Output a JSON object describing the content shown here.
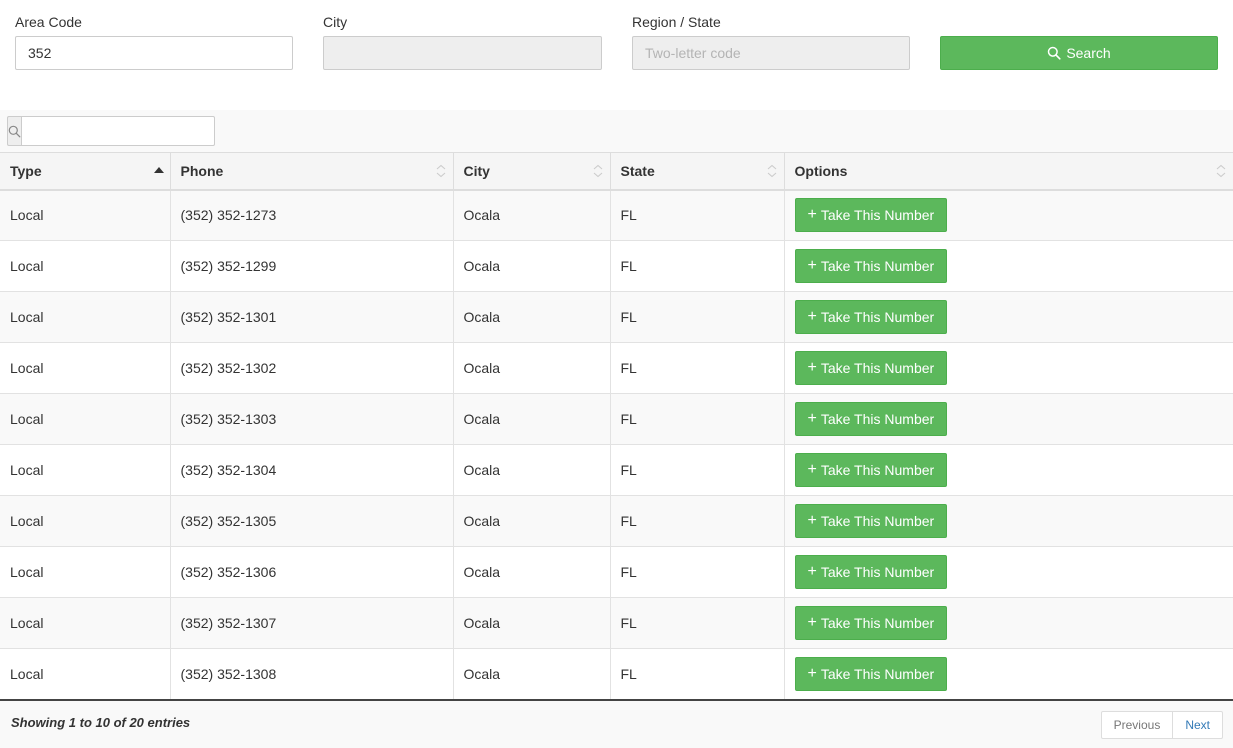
{
  "form": {
    "area_code_label": "Area Code",
    "area_code_value": "352",
    "city_label": "City",
    "city_value": "",
    "region_label": "Region / State",
    "region_placeholder": "Two-letter code",
    "search_label": "Search"
  },
  "table": {
    "filter_value": "",
    "columns": [
      "Type",
      "Phone",
      "City",
      "State",
      "Options"
    ],
    "sort_column": "Type",
    "sort_direction": "ascending",
    "action_label": "Take This Number",
    "rows": [
      {
        "type": "Local",
        "phone": "(352) 352-1273",
        "city": "Ocala",
        "state": "FL"
      },
      {
        "type": "Local",
        "phone": "(352) 352-1299",
        "city": "Ocala",
        "state": "FL"
      },
      {
        "type": "Local",
        "phone": "(352) 352-1301",
        "city": "Ocala",
        "state": "FL"
      },
      {
        "type": "Local",
        "phone": "(352) 352-1302",
        "city": "Ocala",
        "state": "FL"
      },
      {
        "type": "Local",
        "phone": "(352) 352-1303",
        "city": "Ocala",
        "state": "FL"
      },
      {
        "type": "Local",
        "phone": "(352) 352-1304",
        "city": "Ocala",
        "state": "FL"
      },
      {
        "type": "Local",
        "phone": "(352) 352-1305",
        "city": "Ocala",
        "state": "FL"
      },
      {
        "type": "Local",
        "phone": "(352) 352-1306",
        "city": "Ocala",
        "state": "FL"
      },
      {
        "type": "Local",
        "phone": "(352) 352-1307",
        "city": "Ocala",
        "state": "FL"
      },
      {
        "type": "Local",
        "phone": "(352) 352-1308",
        "city": "Ocala",
        "state": "FL"
      }
    ]
  },
  "footer": {
    "info": "Showing 1 to 10 of 20 entries",
    "previous_label": "Previous",
    "next_label": "Next"
  },
  "icons": {
    "search": "search-icon",
    "plus": "plus-icon",
    "sort": "sort-icon"
  },
  "colors": {
    "button_green": "#5cb85c",
    "link_blue": "#337ab7"
  }
}
